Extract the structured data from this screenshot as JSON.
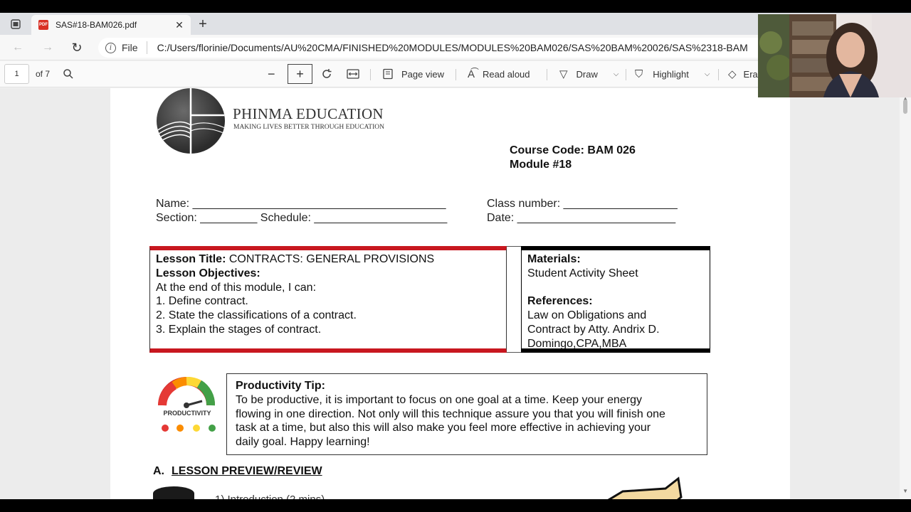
{
  "tab": {
    "title": "SAS#18-BAM026.pdf",
    "close": "✕",
    "new": "+"
  },
  "address": {
    "file_label": "File",
    "url": "C:/Users/florinie/Documents/AU%20CMA/FINISHED%20MODULES/MODULES%20BAM026/SAS%20BAM%20026/SAS%2318-BAM"
  },
  "pdf_toolbar": {
    "page_number": "1",
    "page_total": "of 7",
    "page_view": "Page view",
    "read_aloud": "Read aloud",
    "draw": "Draw",
    "highlight": "Highlight",
    "erase": "Era"
  },
  "document": {
    "brand": "PHINMA EDUCATION",
    "tagline": "MAKING LIVES BETTER THROUGH EDUCATION",
    "course_code": "Course Code: BAM 026",
    "module": "Module #18",
    "name_field": "Name: ________________________________________",
    "section_field": "Section: _________ Schedule: _____________________",
    "class_field": "Class number: __________________",
    "date_field": "Date: _________________________",
    "lesson": {
      "title_label": "Lesson Title:",
      "title_value": " CONTRACTS: GENERAL PROVISIONS",
      "objectives_label": "Lesson Objectives:",
      "intro": "At the end of this module, I can:",
      "objectives": [
        "1. Define contract.",
        "2. State the classifications of a contract.",
        "3. Explain the stages of contract."
      ]
    },
    "materials": {
      "label": "Materials:",
      "value": "Student Activity Sheet",
      "references_label": "References:",
      "references": [
        "Law on Obligations and",
        "Contract by Atty. Andrix D.",
        "Domingo,CPA,MBA"
      ]
    },
    "tip": {
      "label": "Productivity Tip:",
      "lines": [
        "To be productive, it is important to focus on one goal at a time. Keep your energy",
        "flowing in one direction. Not only will this technique assure you that you will finish one",
        "task at a time, but also this will also make you feel more effective in achieving your",
        "daily goal. Happy learning!"
      ],
      "gauge_label": "PRODUCTIVITY"
    },
    "section_a": {
      "letter": "A.",
      "title": "LESSON PREVIEW/REVIEW"
    },
    "intro_cut": "1) Introduction (2 mins)"
  },
  "colors": {
    "lesson_border": "#c8171f",
    "materials_border": "#000000"
  }
}
